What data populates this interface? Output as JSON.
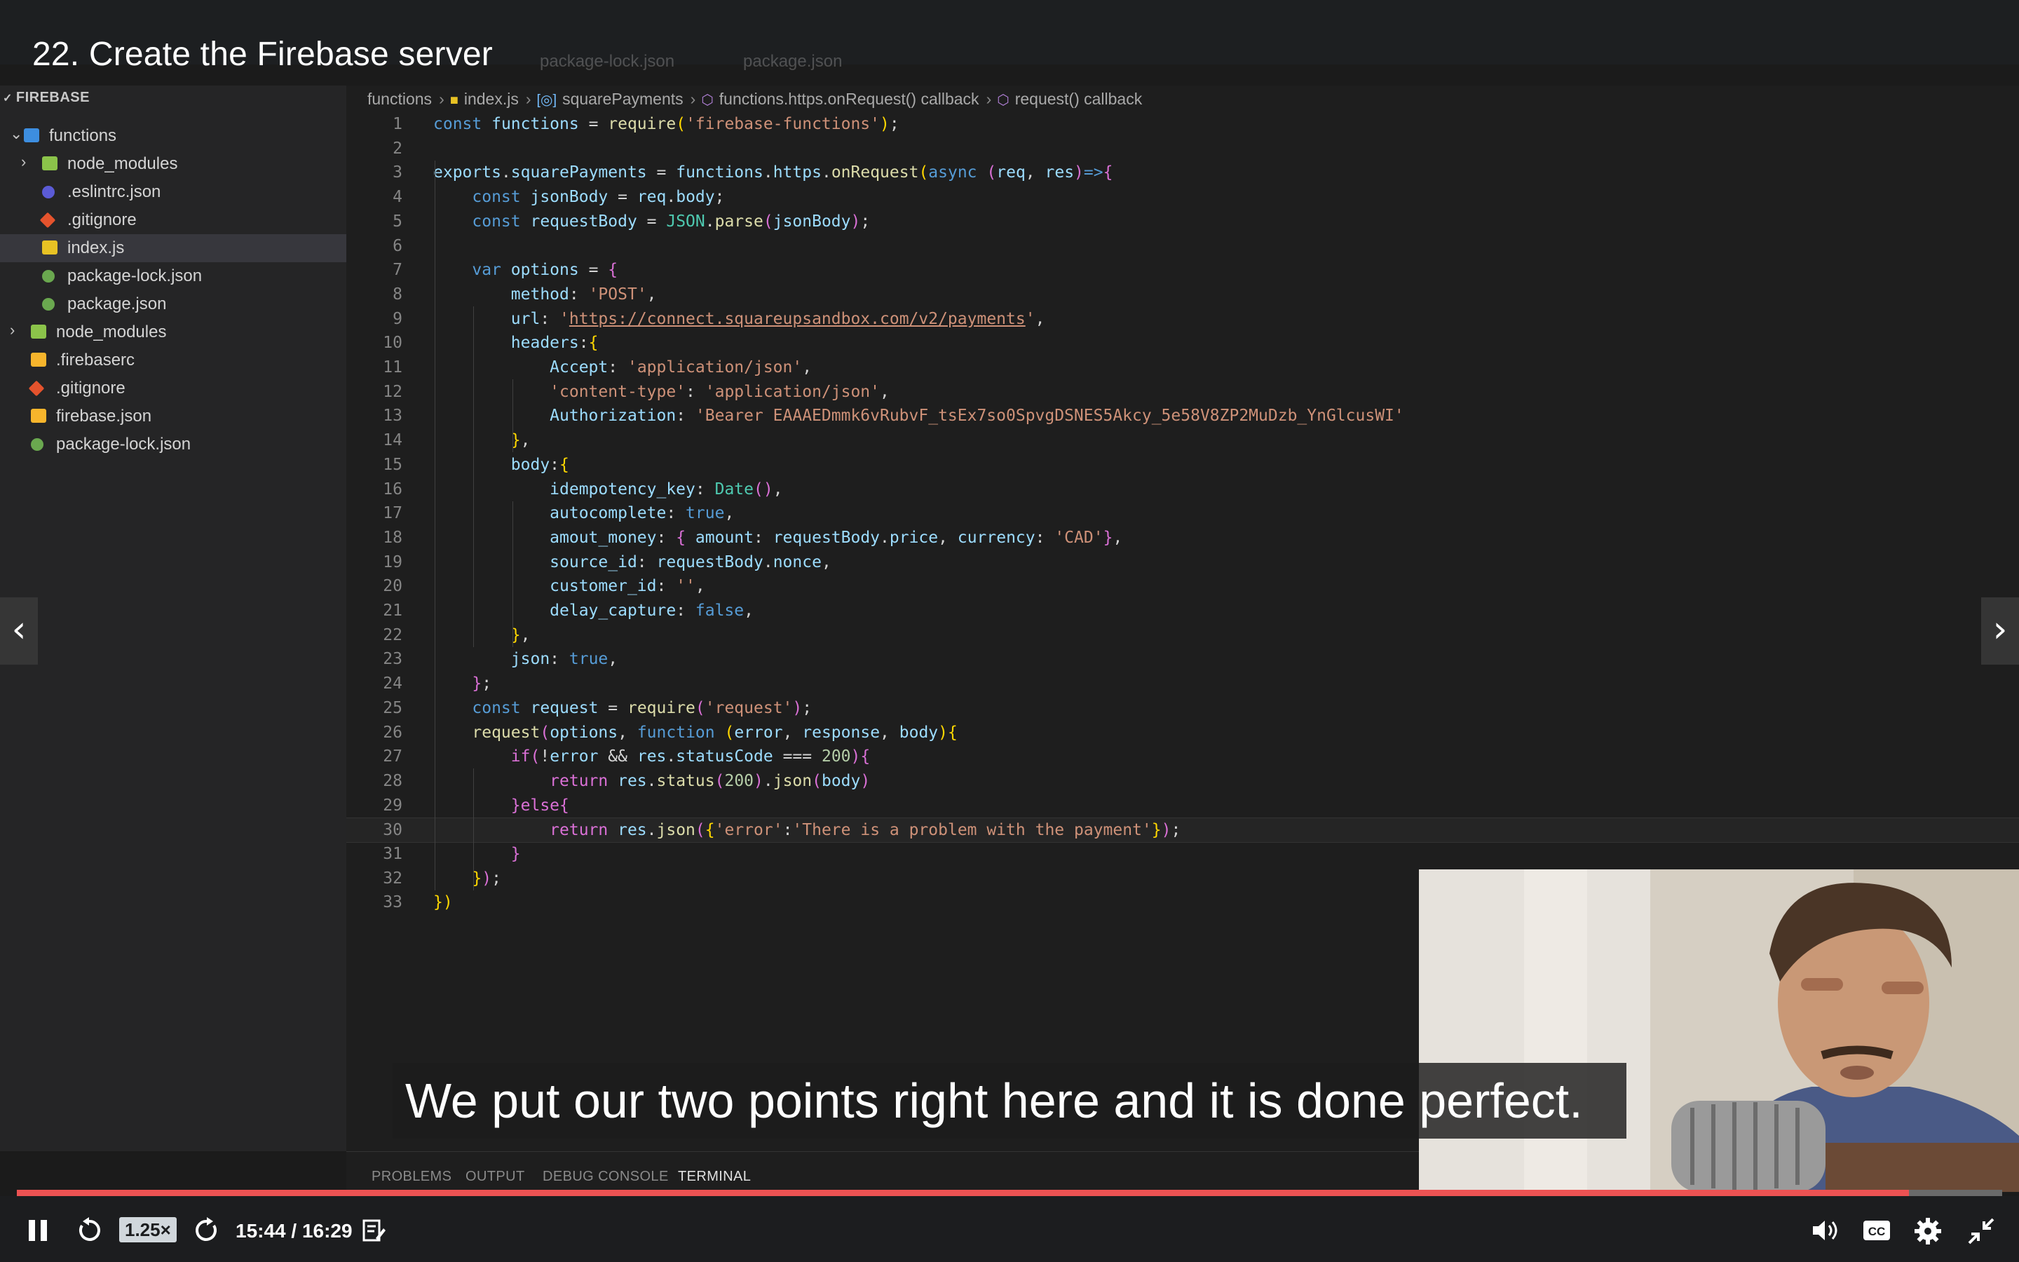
{
  "lecture": {
    "title": "22. Create the Firebase server"
  },
  "ghost_tabs": [
    "package-lock.json",
    "package.json"
  ],
  "explorer": {
    "header": "FIREBASE",
    "items": [
      {
        "label": "functions",
        "type": "folder-open"
      },
      {
        "label": "node_modules",
        "type": "folder"
      },
      {
        "label": ".eslintrc.json",
        "type": "eslint"
      },
      {
        "label": ".gitignore",
        "type": "git"
      },
      {
        "label": "index.js",
        "type": "js",
        "active": true
      },
      {
        "label": "package-lock.json",
        "type": "node"
      },
      {
        "label": "package.json",
        "type": "node"
      },
      {
        "label": "node_modules",
        "type": "folder"
      },
      {
        "label": ".firebaserc",
        "type": "firebase"
      },
      {
        "label": ".gitignore",
        "type": "git"
      },
      {
        "label": "firebase.json",
        "type": "firebase"
      },
      {
        "label": "package-lock.json",
        "type": "node"
      }
    ]
  },
  "breadcrumb": [
    "functions",
    "index.js",
    "squarePayments",
    "functions.https.onRequest() callback",
    "request() callback"
  ],
  "code_lines": [
    [
      [
        "k",
        "const "
      ],
      [
        "v",
        "functions"
      ],
      [
        "t",
        " = "
      ],
      [
        "f",
        "require"
      ],
      [
        "y",
        "("
      ],
      [
        "s",
        "'firebase-functions'"
      ],
      [
        "y",
        ")"
      ],
      [
        "t",
        ";"
      ]
    ],
    [],
    [
      [
        "v",
        "exports"
      ],
      [
        "t",
        "."
      ],
      [
        "v",
        "squarePayments"
      ],
      [
        "t",
        " = "
      ],
      [
        "v",
        "functions"
      ],
      [
        "t",
        "."
      ],
      [
        "v",
        "https"
      ],
      [
        "t",
        "."
      ],
      [
        "f",
        "onRequest"
      ],
      [
        "y",
        "("
      ],
      [
        "k",
        "async "
      ],
      [
        "p",
        "("
      ],
      [
        "v",
        "req"
      ],
      [
        "t",
        ", "
      ],
      [
        "v",
        "res"
      ],
      [
        "p",
        ")"
      ],
      [
        "k",
        "=>"
      ],
      [
        "p",
        "{"
      ]
    ],
    [
      [
        "t",
        "    "
      ],
      [
        "k",
        "const "
      ],
      [
        "v",
        "jsonBody"
      ],
      [
        "t",
        " = "
      ],
      [
        "v",
        "req"
      ],
      [
        "t",
        "."
      ],
      [
        "v",
        "body"
      ],
      [
        "t",
        ";"
      ]
    ],
    [
      [
        "t",
        "    "
      ],
      [
        "k",
        "const "
      ],
      [
        "v",
        "requestBody"
      ],
      [
        "t",
        " = "
      ],
      [
        "c",
        "JSON"
      ],
      [
        "t",
        "."
      ],
      [
        "f",
        "parse"
      ],
      [
        "p",
        "("
      ],
      [
        "v",
        "jsonBody"
      ],
      [
        "p",
        ")"
      ],
      [
        "t",
        ";"
      ]
    ],
    [],
    [
      [
        "t",
        "    "
      ],
      [
        "k",
        "var "
      ],
      [
        "v",
        "options"
      ],
      [
        "t",
        " = "
      ],
      [
        "p",
        "{"
      ]
    ],
    [
      [
        "t",
        "        "
      ],
      [
        "v",
        "method"
      ],
      [
        "t",
        ": "
      ],
      [
        "s",
        "'POST'"
      ],
      [
        "t",
        ","
      ]
    ],
    [
      [
        "t",
        "        "
      ],
      [
        "v",
        "url"
      ],
      [
        "t",
        ": "
      ],
      [
        "s",
        "'"
      ],
      [
        "u",
        "https://connect.squareupsandbox.com/v2/payments"
      ],
      [
        "s",
        "'"
      ],
      [
        "t",
        ","
      ]
    ],
    [
      [
        "t",
        "        "
      ],
      [
        "v",
        "headers"
      ],
      [
        "t",
        ":"
      ],
      [
        "y",
        "{"
      ]
    ],
    [
      [
        "t",
        "            "
      ],
      [
        "v",
        "Accept"
      ],
      [
        "t",
        ": "
      ],
      [
        "s",
        "'application/json'"
      ],
      [
        "t",
        ","
      ]
    ],
    [
      [
        "t",
        "            "
      ],
      [
        "s",
        "'content-type'"
      ],
      [
        "t",
        ": "
      ],
      [
        "s",
        "'application/json'"
      ],
      [
        "t",
        ","
      ]
    ],
    [
      [
        "t",
        "            "
      ],
      [
        "v",
        "Authorization"
      ],
      [
        "t",
        ": "
      ],
      [
        "s",
        "'Bearer EAAAEDmmk6vRubvF_tsEx7so0SpvgDSNES5Akcy_5e58V8ZP2MuDzb_YnGlcusWI'"
      ]
    ],
    [
      [
        "t",
        "        "
      ],
      [
        "y",
        "}"
      ],
      [
        "t",
        ","
      ]
    ],
    [
      [
        "t",
        "        "
      ],
      [
        "v",
        "body"
      ],
      [
        "t",
        ":"
      ],
      [
        "y",
        "{"
      ]
    ],
    [
      [
        "t",
        "            "
      ],
      [
        "v",
        "idempotency_key"
      ],
      [
        "t",
        ": "
      ],
      [
        "c",
        "Date"
      ],
      [
        "p",
        "()"
      ],
      [
        "t",
        ","
      ]
    ],
    [
      [
        "t",
        "            "
      ],
      [
        "v",
        "autocomplete"
      ],
      [
        "t",
        ": "
      ],
      [
        "k",
        "true"
      ],
      [
        "t",
        ","
      ]
    ],
    [
      [
        "t",
        "            "
      ],
      [
        "v",
        "amout_money"
      ],
      [
        "t",
        ": "
      ],
      [
        "p",
        "{ "
      ],
      [
        "v",
        "amount"
      ],
      [
        "t",
        ": "
      ],
      [
        "v",
        "requestBody"
      ],
      [
        "t",
        "."
      ],
      [
        "v",
        "price"
      ],
      [
        "t",
        ", "
      ],
      [
        "v",
        "currency"
      ],
      [
        "t",
        ": "
      ],
      [
        "s",
        "'CAD'"
      ],
      [
        "p",
        "}"
      ],
      [
        "t",
        ","
      ]
    ],
    [
      [
        "t",
        "            "
      ],
      [
        "v",
        "source_id"
      ],
      [
        "t",
        ": "
      ],
      [
        "v",
        "requestBody"
      ],
      [
        "t",
        "."
      ],
      [
        "v",
        "nonce"
      ],
      [
        "t",
        ","
      ]
    ],
    [
      [
        "t",
        "            "
      ],
      [
        "v",
        "customer_id"
      ],
      [
        "t",
        ": "
      ],
      [
        "s",
        "''"
      ],
      [
        "t",
        ","
      ]
    ],
    [
      [
        "t",
        "            "
      ],
      [
        "v",
        "delay_capture"
      ],
      [
        "t",
        ": "
      ],
      [
        "k",
        "false"
      ],
      [
        "t",
        ","
      ]
    ],
    [
      [
        "t",
        "        "
      ],
      [
        "y",
        "}"
      ],
      [
        "t",
        ","
      ]
    ],
    [
      [
        "t",
        "        "
      ],
      [
        "v",
        "json"
      ],
      [
        "t",
        ": "
      ],
      [
        "k",
        "true"
      ],
      [
        "t",
        ","
      ]
    ],
    [
      [
        "t",
        "    "
      ],
      [
        "p",
        "}"
      ],
      [
        "t",
        ";"
      ]
    ],
    [
      [
        "t",
        "    "
      ],
      [
        "k",
        "const "
      ],
      [
        "v",
        "request"
      ],
      [
        "t",
        " = "
      ],
      [
        "f",
        "require"
      ],
      [
        "p",
        "("
      ],
      [
        "s",
        "'request'"
      ],
      [
        "p",
        ")"
      ],
      [
        "t",
        ";"
      ]
    ],
    [
      [
        "t",
        "    "
      ],
      [
        "f",
        "request"
      ],
      [
        "p",
        "("
      ],
      [
        "v",
        "options"
      ],
      [
        "t",
        ", "
      ],
      [
        "k",
        "function "
      ],
      [
        "y",
        "("
      ],
      [
        "v",
        "error"
      ],
      [
        "t",
        ", "
      ],
      [
        "v",
        "response"
      ],
      [
        "t",
        ", "
      ],
      [
        "v",
        "body"
      ],
      [
        "y",
        ")"
      ],
      [
        "y",
        "{"
      ]
    ],
    [
      [
        "t",
        "        "
      ],
      [
        "p",
        "if"
      ],
      [
        "p",
        "("
      ],
      [
        "t",
        "!"
      ],
      [
        "v",
        "error"
      ],
      [
        "t",
        " && "
      ],
      [
        "v",
        "res"
      ],
      [
        "t",
        "."
      ],
      [
        "v",
        "statusCode"
      ],
      [
        "t",
        " === "
      ],
      [
        "n",
        "200"
      ],
      [
        "p",
        ")"
      ],
      [
        "p",
        "{"
      ]
    ],
    [
      [
        "t",
        "            "
      ],
      [
        "p",
        "return "
      ],
      [
        "v",
        "res"
      ],
      [
        "t",
        "."
      ],
      [
        "f",
        "status"
      ],
      [
        "p",
        "("
      ],
      [
        "n",
        "200"
      ],
      [
        "p",
        ")"
      ],
      [
        "t",
        "."
      ],
      [
        "f",
        "json"
      ],
      [
        "p",
        "("
      ],
      [
        "v",
        "body"
      ],
      [
        "p",
        ")"
      ]
    ],
    [
      [
        "t",
        "        "
      ],
      [
        "p",
        "}"
      ],
      [
        "p",
        "else"
      ],
      [
        "p",
        "{"
      ]
    ],
    [
      [
        "t",
        "            "
      ],
      [
        "p",
        "return "
      ],
      [
        "v",
        "res"
      ],
      [
        "t",
        "."
      ],
      [
        "f",
        "json"
      ],
      [
        "p",
        "("
      ],
      [
        "y",
        "{"
      ],
      [
        "s",
        "'error'"
      ],
      [
        "t",
        ":"
      ],
      [
        "s",
        "'There is a problem with the payment'"
      ],
      [
        "y",
        "}"
      ],
      [
        "p",
        ")"
      ],
      [
        "t",
        ";"
      ]
    ],
    [
      [
        "t",
        "        "
      ],
      [
        "p",
        "}"
      ]
    ],
    [
      [
        "t",
        "    "
      ],
      [
        "y",
        "}"
      ],
      [
        "p",
        ")"
      ],
      [
        "t",
        ";"
      ]
    ],
    [
      [
        "y",
        "}"
      ],
      [
        "y",
        ")"
      ]
    ]
  ],
  "code_current_line": 30,
  "panel_tabs": [
    "PROBLEMS",
    "OUTPUT",
    "DEBUG CONSOLE",
    "TERMINAL"
  ],
  "panel_active": "TERMINAL",
  "subtitle": "We put our two points right here and it is done perfect.",
  "player": {
    "speed": "1.25×",
    "time": "15:44 / 16:29",
    "progress": 0.953
  },
  "colors": {
    "accent": "#ec5252",
    "editor_bg": "#1e1e1e",
    "sidebar_bg": "#252526"
  },
  "icons": [
    "pause-icon",
    "rewind-icon",
    "forward-icon",
    "notes-icon",
    "volume-icon",
    "captions-icon",
    "settings-icon",
    "exit-fullscreen-icon",
    "prev-lecture-icon",
    "next-lecture-icon"
  ]
}
